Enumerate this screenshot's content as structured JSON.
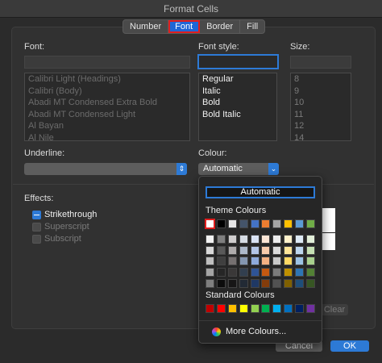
{
  "window": {
    "title": "Format Cells"
  },
  "tabs": [
    {
      "label": "Number",
      "active": false
    },
    {
      "label": "Font",
      "active": true
    },
    {
      "label": "Border",
      "active": false
    },
    {
      "label": "Fill",
      "active": false
    }
  ],
  "font": {
    "label": "Font:",
    "value": "",
    "items": [
      "Calibri Light (Headings)",
      "Calibri (Body)",
      "Abadi MT Condensed Extra Bold",
      "Abadi MT Condensed Light",
      "Al Bayan",
      "Al Nile"
    ]
  },
  "font_style": {
    "label": "Font style:",
    "value": "",
    "items": [
      "Regular",
      "Italic",
      "Bold",
      "Bold Italic"
    ]
  },
  "size": {
    "label": "Size:",
    "value": "",
    "items": [
      "8",
      "9",
      "10",
      "11",
      "12",
      "14"
    ]
  },
  "underline": {
    "label": "Underline:",
    "value": ""
  },
  "colour": {
    "label": "Colour:",
    "value": "Automatic"
  },
  "effects": {
    "label": "Effects:",
    "items": [
      {
        "label": "Strikethrough",
        "checked": true,
        "enabled": true
      },
      {
        "label": "Superscript",
        "checked": false,
        "enabled": false
      },
      {
        "label": "Subscript",
        "checked": false,
        "enabled": false
      }
    ]
  },
  "colour_popup": {
    "automatic_label": "Automatic",
    "theme_label": "Theme Colours",
    "standard_label": "Standard Colours",
    "more_label": "More Colours...",
    "theme_top": [
      "#ffffff",
      "#000000",
      "#e7e6e6",
      "#44546a",
      "#4472c4",
      "#ed7d31",
      "#a5a5a5",
      "#ffc000",
      "#5b9bd5",
      "#70ad47"
    ],
    "theme_shades": [
      [
        "#f2f2f2",
        "#7f7f7f",
        "#d0cece",
        "#d6dce4",
        "#d9e2f3",
        "#fbe5d5",
        "#ededed",
        "#fff2cc",
        "#deebf6",
        "#e2efd9"
      ],
      [
        "#d8d8d8",
        "#595959",
        "#aeabab",
        "#adb9ca",
        "#b4c6e7",
        "#f7cbac",
        "#dbdbdb",
        "#fee599",
        "#bdd7ee",
        "#c5e0b3"
      ],
      [
        "#bfbfbf",
        "#3f3f3f",
        "#757070",
        "#8496b0",
        "#8eaadb",
        "#f4b183",
        "#c9c9c9",
        "#ffd965",
        "#9cc3e5",
        "#a8d08d"
      ],
      [
        "#a5a5a5",
        "#262626",
        "#3a3838",
        "#323f4f",
        "#2f5496",
        "#c45911",
        "#7b7b7b",
        "#bf9000",
        "#2e75b5",
        "#538135"
      ],
      [
        "#7f7f7f",
        "#0c0c0c",
        "#171616",
        "#222a35",
        "#1f3864",
        "#833c0b",
        "#525252",
        "#7f6000",
        "#1e4e79",
        "#375623"
      ]
    ],
    "standard": [
      "#c00000",
      "#ff0000",
      "#ffc000",
      "#ffff00",
      "#92d050",
      "#00b050",
      "#00b0f0",
      "#0070c0",
      "#002060",
      "#7030a0"
    ]
  },
  "buttons": {
    "clear": "Clear",
    "cancel": "Cancel",
    "ok": "OK"
  }
}
